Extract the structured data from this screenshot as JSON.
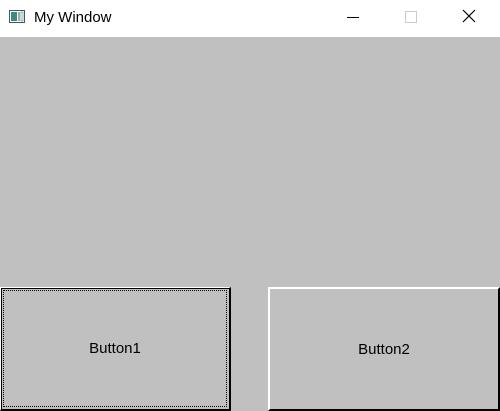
{
  "window": {
    "title": "My Window",
    "icons": {
      "app": "window-app-icon",
      "minimize": "minimize-icon",
      "maximize": "maximize-icon",
      "close": "close-icon"
    }
  },
  "buttons": [
    {
      "label": "Button1",
      "focused": true
    },
    {
      "label": "Button2",
      "focused": false
    }
  ],
  "colors": {
    "client_background": "#c0c0c0",
    "titlebar_background": "#ffffff",
    "maximize_disabled": "#cccccc"
  }
}
